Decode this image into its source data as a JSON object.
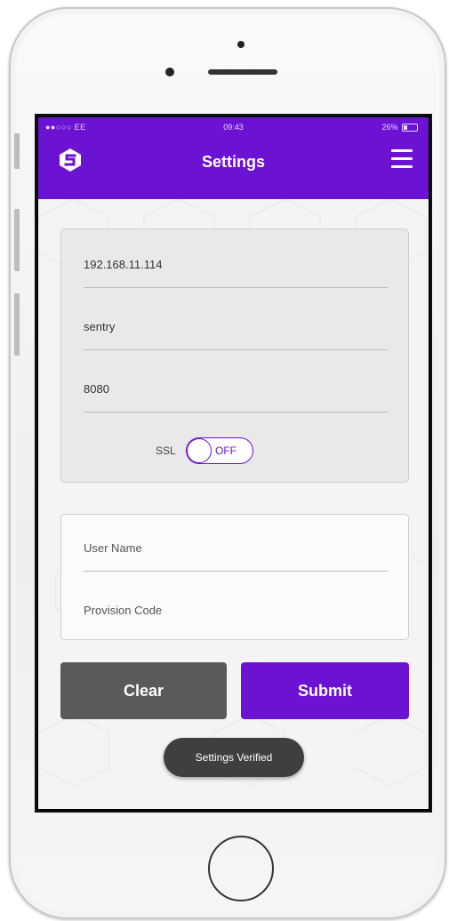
{
  "status_bar": {
    "carrier": "●●○○○ EE",
    "time": "09:43",
    "battery_text": "26%"
  },
  "header": {
    "title": "Settings",
    "logo_icon": "app-logo-icon",
    "menu_icon": "hamburger-menu-icon"
  },
  "server_card": {
    "host_value": "192.168.11.114",
    "path_value": "sentry",
    "port_value": "8080",
    "ssl_label": "SSL",
    "ssl_toggle_text": "OFF",
    "ssl_enabled": false
  },
  "credentials_card": {
    "username_placeholder": "User Name",
    "provision_placeholder": "Provision Code"
  },
  "buttons": {
    "clear_label": "Clear",
    "submit_label": "Submit"
  },
  "toast": {
    "message": "Settings Verified"
  },
  "colors": {
    "accent": "#6c12d3",
    "clear_button": "#5a5a5a",
    "toast_bg": "#3f3f3f"
  }
}
